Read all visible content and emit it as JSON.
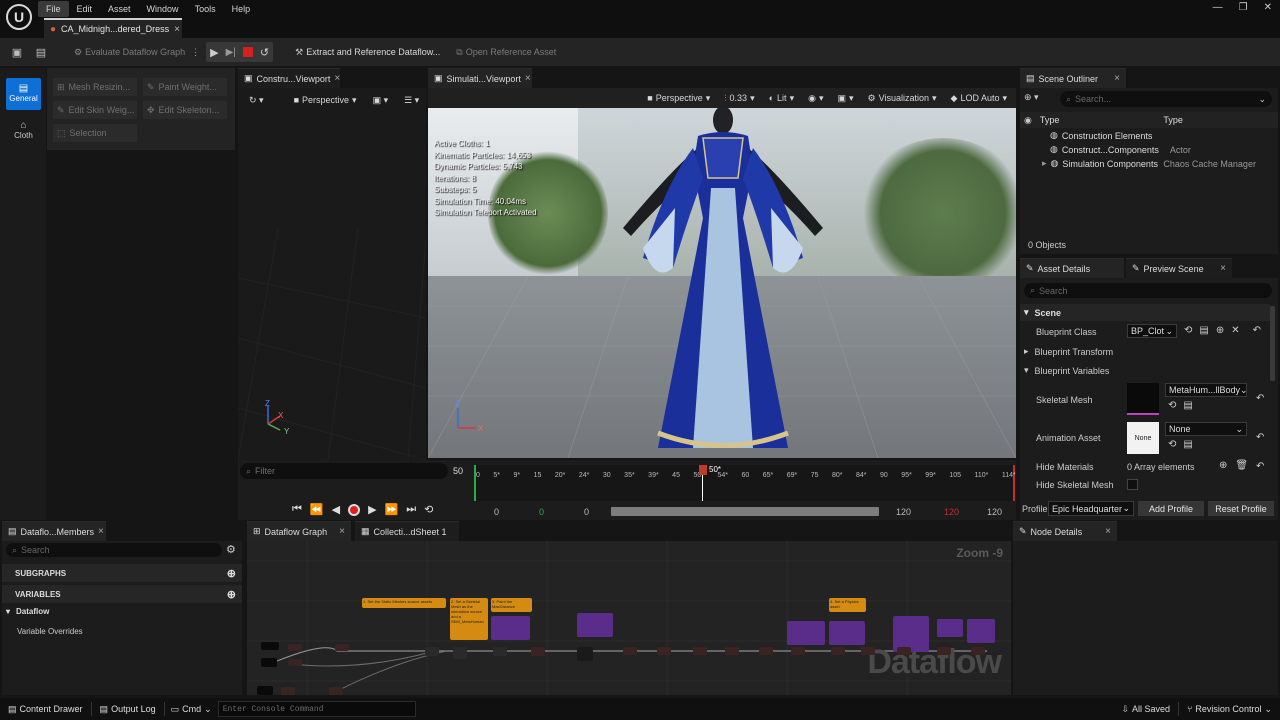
{
  "menu": {
    "file": "File",
    "edit": "Edit",
    "asset": "Asset",
    "window": "Window",
    "tools": "Tools",
    "help": "Help"
  },
  "doc_tab": {
    "label": "CA_Midnigh...dered_Dress"
  },
  "toolbar": {
    "evaluate": "Evaluate Dataflow Graph",
    "extract": "Extract and Reference Dataflow...",
    "open_ref": "Open Reference Asset"
  },
  "modes": [
    {
      "label": "General"
    },
    {
      "label": "Cloth"
    }
  ],
  "tools": [
    "Mesh Resizin...",
    "Paint Weight...",
    "Edit Skin Weig...",
    "Edit Skeleton...",
    "Selection"
  ],
  "construct_viewport": {
    "tab": "Constru...Viewport",
    "perspective": "Perspective"
  },
  "sim_viewport": {
    "tab": "Simulati...Viewport",
    "perspective": "Perspective",
    "speed": "0.33",
    "lit": "Lit",
    "visualization": "Visualization",
    "lod": "LOD Auto",
    "stats": [
      "Active Cloths: 1",
      "Kinematic Particles: 14,653",
      "Dynamic Particles: 5,743",
      "Iterations: 8",
      "Substeps: 5",
      "Simulation Time: 40.04ms",
      "Simulation Teleport Activated"
    ]
  },
  "timeline": {
    "filter_placeholder": "Filter",
    "current": "50",
    "current_marker": "50*",
    "ticks": [
      "0",
      "5*",
      "9*",
      "15",
      "20*",
      "24*",
      "30",
      "35*",
      "39*",
      "45",
      "50*",
      "54*",
      "60",
      "65*",
      "69*",
      "75",
      "80*",
      "84*",
      "90",
      "95*",
      "99*",
      "105",
      "110*",
      "114*"
    ],
    "start": "0",
    "range_start_green": "0",
    "range_start": "0",
    "range_end": "120",
    "range_end_red": "120",
    "end": "120"
  },
  "outliner": {
    "tab": "Scene Outliner",
    "search_placeholder": "Search...",
    "col_type1": "Type",
    "col_type2": "Type",
    "items": [
      {
        "name": "Construction Elements",
        "type": ""
      },
      {
        "name": "Construct...Components",
        "type": "Actor"
      },
      {
        "name": "Simulation Components",
        "type": "Chaos Cache Manager"
      }
    ],
    "count": "0 Objects"
  },
  "details": {
    "tab_asset": "Asset Details",
    "tab_preview": "Preview Scene",
    "search_placeholder": "Search",
    "section_scene": "Scene",
    "blueprint_class_label": "Blueprint Class",
    "blueprint_class_value": "BP_Clot",
    "blueprint_transform": "Blueprint Transform",
    "blueprint_variables": "Blueprint Variables",
    "skeletal_mesh_label": "Skeletal Mesh",
    "skeletal_mesh_value": "MetaHum...llBody",
    "animation_asset_label": "Animation Asset",
    "animation_asset_value": "None",
    "animation_thumb": "None",
    "hide_materials_label": "Hide Materials",
    "hide_materials_value": "0 Array elements",
    "hide_skeletal_label": "Hide Skeletal Mesh",
    "profile_label": "Profile",
    "profile_value": "Epic Headquarter",
    "add_profile": "Add Profile",
    "reset_profile": "Reset Profile"
  },
  "members": {
    "tab": "Dataflo...Members",
    "search_placeholder": "Search",
    "subgraphs": "SUBGRAPHS",
    "variables": "VARIABLES",
    "dataflow": "Dataflow",
    "variable_overrides": "Variable Overrides"
  },
  "graph": {
    "tab1": "Dataflow Graph",
    "tab2": "Collecti...dSheet 1",
    "zoom": "Zoom -9",
    "watermark": "Dataflow",
    "comments": [
      "1. Set the Static Meshes source assets",
      "2. Set a Skeletal Mesh as the simulation source and a SKM_MetaHuman",
      "3. Paint the MaxDistance",
      "4. Set a Physics asset"
    ]
  },
  "node_details": {
    "tab": "Node Details"
  },
  "statusbar": {
    "content_drawer": "Content Drawer",
    "output_log": "Output Log",
    "cmd": "Cmd",
    "console_placeholder": "Enter Console Command",
    "saved": "All Saved",
    "revision": "Revision Control"
  },
  "colors": {
    "accent": "#0e6fd6",
    "record": "#e02020",
    "comment_orange": "#d58a12",
    "comment_purple": "#5b2d8a"
  }
}
